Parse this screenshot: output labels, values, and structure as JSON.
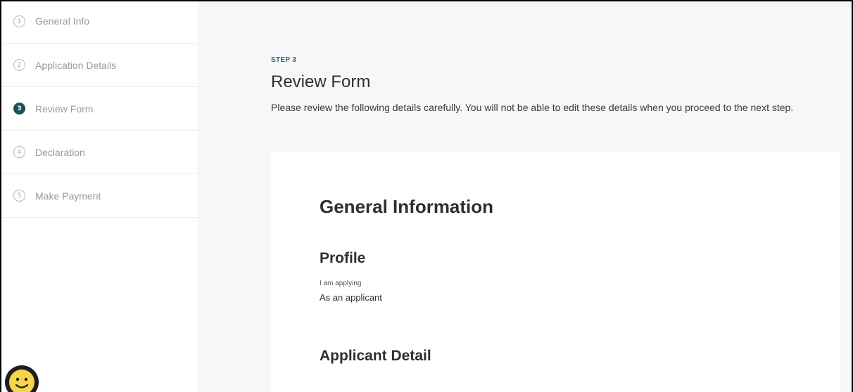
{
  "sidebar": {
    "steps": [
      {
        "num": "1",
        "label": "General Info"
      },
      {
        "num": "2",
        "label": "Application Details"
      },
      {
        "num": "3",
        "label": "Review Form"
      },
      {
        "num": "4",
        "label": "Declaration"
      },
      {
        "num": "5",
        "label": "Make Payment"
      }
    ],
    "active_step": 3,
    "helper_icon": "smiley-face-icon"
  },
  "main": {
    "step_tag": "STEP 3",
    "title": "Review Form",
    "description": "Please review the following details carefully. You will not be able to edit these details when you proceed to the next step."
  },
  "review": {
    "section_title": "General Information",
    "profile": {
      "title": "Profile",
      "field_label": "I am applying",
      "field_value": "As an applicant"
    },
    "applicant_detail_title": "Applicant Detail"
  },
  "colors": {
    "accent": "#1d6f78",
    "active_step_bg": "#1d4f5a",
    "page_bg": "#f7f7f7",
    "helper_yellow": "#f7d54a"
  }
}
